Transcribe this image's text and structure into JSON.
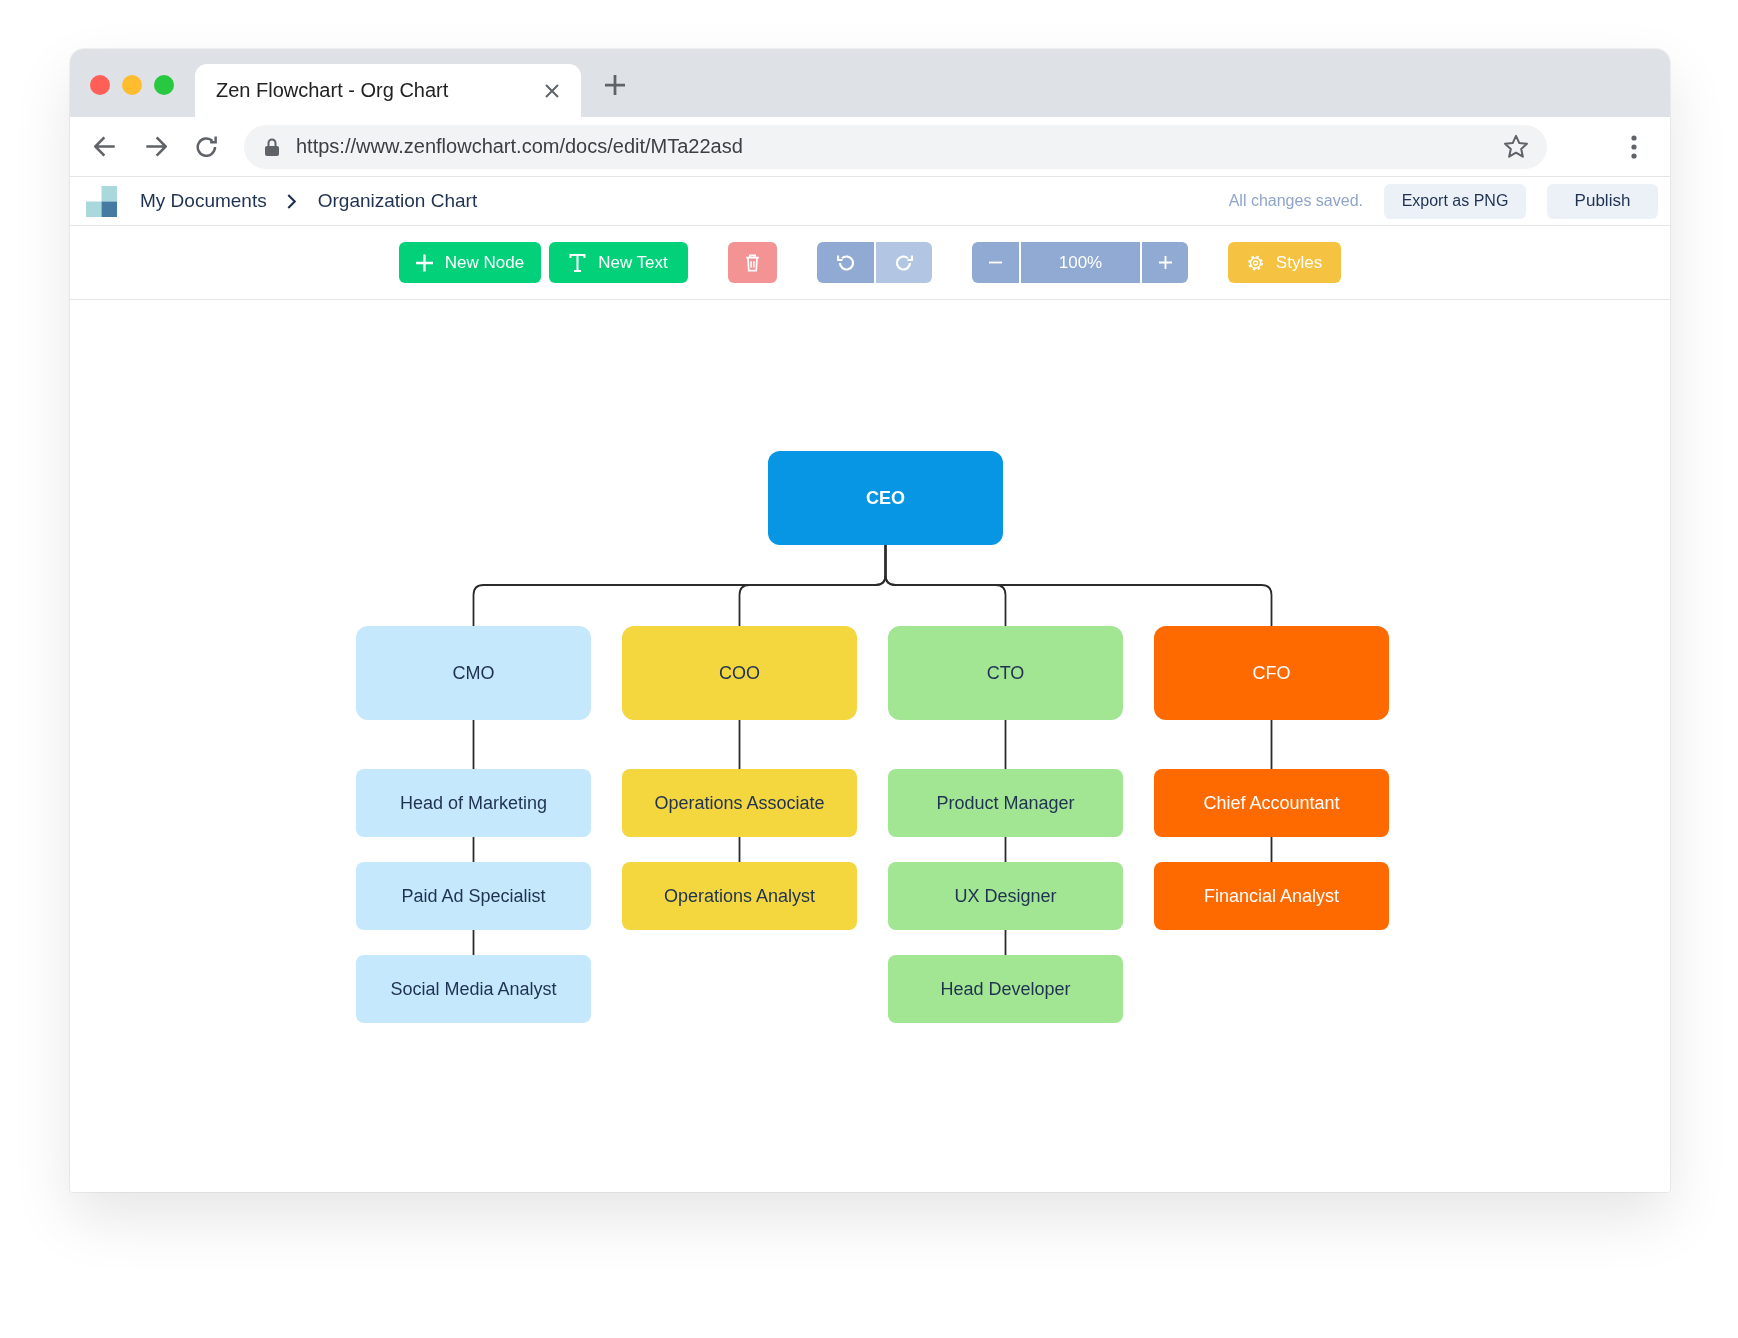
{
  "browser": {
    "tab_title": "Zen Flowchart - Org Chart",
    "url": "https://www.zenflowchart.com/docs/edit/MTa22asd"
  },
  "app_header": {
    "breadcrumbs": [
      "My Documents",
      "Organization Chart"
    ],
    "save_status": "All changes saved.",
    "buttons": [
      "Export as PNG",
      "Publish"
    ]
  },
  "toolbar": {
    "groups": [
      {
        "items": [
          {
            "kind": "add",
            "label": "New Node"
          },
          {
            "kind": "text",
            "label": "New Text"
          }
        ]
      },
      {
        "items": [
          {
            "kind": "delete"
          }
        ]
      },
      {
        "items": [
          {
            "kind": "undo",
            "disabled": false
          },
          {
            "kind": "redo",
            "disabled": true
          }
        ]
      },
      {
        "items": [
          {
            "kind": "minus"
          },
          {
            "kind": "zoom",
            "label": "100%"
          },
          {
            "kind": "plus"
          }
        ]
      },
      {
        "items": [
          {
            "kind": "styles",
            "label": "Styles"
          }
        ]
      }
    ]
  },
  "chart": {
    "root": {
      "label": "CEO",
      "color": "#0796e3",
      "children": [
        {
          "label": "CMO",
          "color": "#c5e8fc",
          "children": [
            {
              "label": "Head of Marketing",
              "color": "#c5e8fc",
              "children": [
                {
                  "label": "Paid Ad Specialist",
                  "color": "#c5e8fc",
                  "children": [
                    {
                      "label": "Social Media Analyst",
                      "color": "#c5e8fc"
                    }
                  ]
                }
              ]
            }
          ]
        },
        {
          "label": "COO",
          "color": "#f4d63e",
          "children": [
            {
              "label": "Operations Associate",
              "color": "#f4d63e",
              "children": [
                {
                  "label": "Operations Analyst",
                  "color": "#f4d63e"
                }
              ]
            }
          ]
        },
        {
          "label": "CTO",
          "color": "#a2e592",
          "children": [
            {
              "label": "Product Manager",
              "color": "#a2e592",
              "children": [
                {
                  "label": "UX Designer",
                  "color": "#a2e592",
                  "children": [
                    {
                      "label": "Head Developer",
                      "color": "#a2e592"
                    }
                  ]
                }
              ]
            }
          ]
        },
        {
          "label": "CFO",
          "color": "#ff6a00",
          "children": [
            {
              "label": "Chief Accountant",
              "color": "#ff6a00",
              "children": [
                {
                  "label": "Financial Analyst",
                  "color": "#ff6a00"
                }
              ]
            }
          ]
        }
      ]
    }
  }
}
